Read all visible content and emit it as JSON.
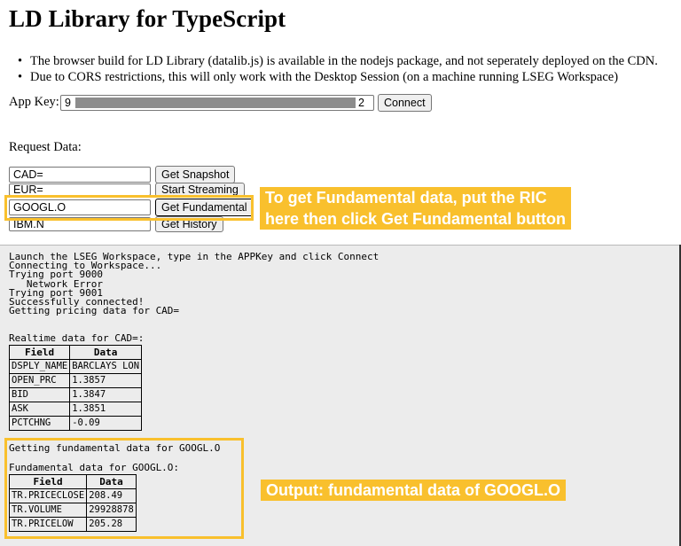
{
  "header": {
    "title": "LD Library for TypeScript"
  },
  "notes": [
    "The browser build for LD Library (datalib.js) is available in the nodejs package, and not seperately deployed on the CDN.",
    "Due to CORS restrictions, this will only work with the Desktop Session (on a machine running LSEG Workspace)"
  ],
  "appkey": {
    "label": "App Key:",
    "value_start": "9",
    "value_end": "2",
    "connect_label": "Connect"
  },
  "request": {
    "label": "Request Data:",
    "rows": [
      {
        "value": "CAD=",
        "button": "Get Snapshot"
      },
      {
        "value": "EUR=",
        "button": "Start Streaming"
      },
      {
        "value": "GOOGL.O",
        "button": "Get Fundamental"
      },
      {
        "value": "IBM.N",
        "button": "Get History"
      }
    ]
  },
  "annotations": {
    "fundamental_line1": "To get Fundamental data, put the RIC",
    "fundamental_line2": "here then click Get Fundamental button",
    "output": "Output: fundamental data of GOOGL.O",
    "color": "#f9c02d"
  },
  "console": {
    "log_lines": [
      "Launch the LSEG Workspace, type in the APPKey and click Connect",
      "Connecting to Workspace...",
      "Trying port 9000",
      "   Network Error",
      "Trying port 9001",
      "Successfully connected!",
      "Getting pricing data for CAD="
    ],
    "realtime_heading": "Realtime data for CAD=:",
    "realtime_headers": [
      "Field",
      "Data"
    ],
    "realtime_rows": [
      [
        "DSPLY_NAME",
        "BARCLAYS LON"
      ],
      [
        "OPEN_PRC",
        "1.3857"
      ],
      [
        "BID",
        "1.3847"
      ],
      [
        "ASK",
        "1.3851"
      ],
      [
        "PCTCHNG",
        "-0.09"
      ]
    ],
    "fundamental_getting": "Getting fundamental data for GOOGL.O",
    "fundamental_heading": "Fundamental data for GOOGL.O:",
    "fundamental_headers": [
      "Field",
      "Data"
    ],
    "fundamental_rows": [
      [
        "TR.PRICECLOSE",
        "208.49"
      ],
      [
        "TR.VOLUME",
        "29928878"
      ],
      [
        "TR.PRICELOW",
        "205.28"
      ]
    ]
  }
}
